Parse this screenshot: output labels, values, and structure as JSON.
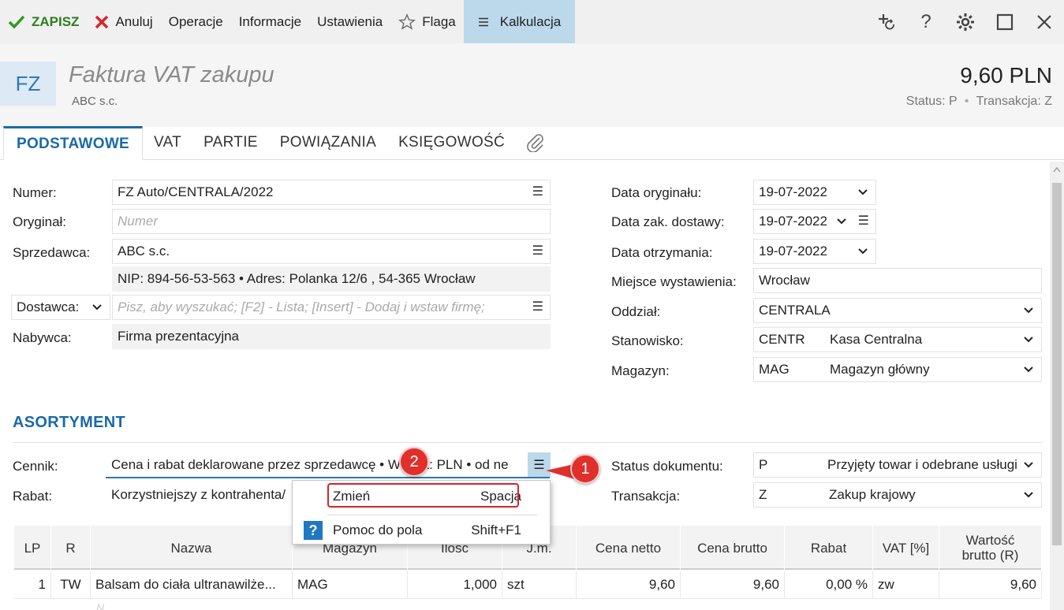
{
  "toolbar": {
    "save": "ZAPISZ",
    "cancel": "Anuluj",
    "operations": "Operacje",
    "information": "Informacje",
    "settings": "Ustawienia",
    "flag": "Flaga",
    "calculation": "Kalkulacja",
    "help_symbol": "?"
  },
  "header": {
    "badge": "FZ",
    "title": "Faktura VAT zakupu",
    "subtitle": "ABC s.c.",
    "amount": "9,60 PLN",
    "status_label": "Status:",
    "status_value": "P",
    "transaction_label": "Transakcja:",
    "transaction_value": "Z"
  },
  "tabs": [
    "PODSTAWOWE",
    "VAT",
    "PARTIE",
    "POWIĄZANIA",
    "KSIĘGOWOŚĆ"
  ],
  "form_left": {
    "number_label": "Numer:",
    "number_value": "FZ Auto/CENTRALA/2022",
    "original_label": "Oryginał:",
    "original_placeholder": "Numer",
    "seller_label": "Sprzedawca:",
    "seller_value": "ABC s.c.",
    "seller_details": "NIP:  894-56-53-563  •  Adres:  Polanka  12/6 , 54-365 Wrocław",
    "supplier_label": "Dostawca:",
    "supplier_placeholder": "Pisz, aby wyszukać; [F2] - Lista; [Insert] - Dodaj i wstaw firmę;",
    "buyer_label": "Nabywca:",
    "buyer_value": "Firma prezentacyjna"
  },
  "form_right": {
    "date_original_label": "Data oryginału:",
    "date_original_value": "19-07-2022",
    "date_delivery_label": "Data zak. dostawy:",
    "date_delivery_value": "19-07-2022",
    "date_received_label": "Data otrzymania:",
    "date_received_value": "19-07-2022",
    "place_label": "Miejsce wystawienia:",
    "place_value": "Wrocław",
    "branch_label": "Oddział:",
    "branch_value": "CENTRALA",
    "station_label": "Stanowisko:",
    "station_code": "CENTR",
    "station_name": "Kasa Centralna",
    "warehouse_label": "Magazyn:",
    "warehouse_code": "MAG",
    "warehouse_name": "Magazyn główny"
  },
  "assortment": {
    "title": "ASORTYMENT",
    "pricelist_label": "Cennik:",
    "pricelist_value": "Cena i rabat deklarowane przez sprzedawcę • Waluta: PLN • od ne",
    "discount_label": "Rabat:",
    "discount_value": "Korzystniejszy z kontrahenta/",
    "doc_status_label": "Status dokumentu:",
    "doc_status_code": "P",
    "doc_status_name": "Przyjęty towar i odebrane usługi",
    "transaction_label": "Transakcja:",
    "transaction_code": "Z",
    "transaction_name": "Zakup krajowy"
  },
  "popup": {
    "change_label": "Zmień",
    "change_key": "Spacja",
    "help_label": "Pomoc do pola",
    "help_key": "Shift+F1",
    "help_icon": "?"
  },
  "badges": {
    "one": "1",
    "two": "2"
  },
  "table": {
    "headers": [
      "LP",
      "R",
      "Nazwa",
      "Magazyn",
      "Ilość",
      "J.m.",
      "Cena netto",
      "Cena brutto",
      "Rabat",
      "VAT [%]",
      "Wartość brutto (R)"
    ],
    "rows": [
      [
        "1",
        "TW",
        "Balsam do ciała ultranawilże...",
        "MAG",
        "1,000",
        "szt",
        "9,60",
        "9,60",
        "0,00 %",
        "zw",
        "9,60"
      ]
    ],
    "new_row_placeholder": "N..."
  },
  "colors": {
    "accent": "#1a6aa8",
    "toolbar_active": "#bcd9ec",
    "save_green": "#2e7d1f",
    "cancel_red": "#d9232e",
    "badge_red": "#e0302b"
  }
}
